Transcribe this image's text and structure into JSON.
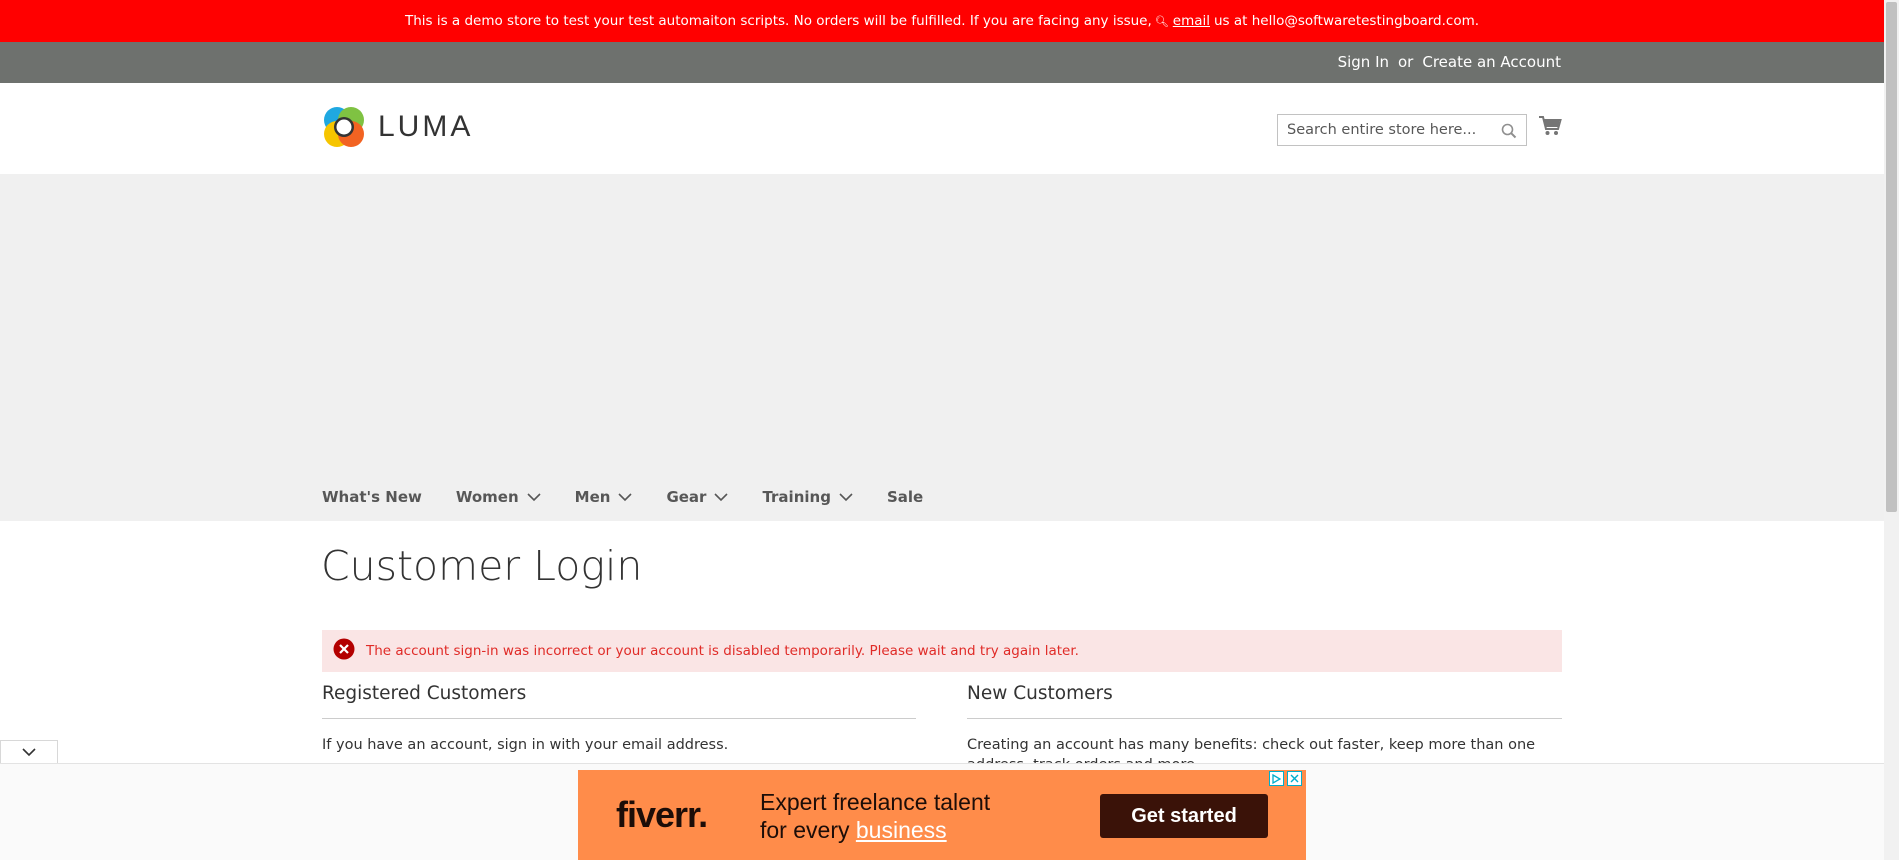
{
  "demo_notice": {
    "text_before": "This is a demo store to test your test automaiton scripts. No orders will be fulfilled. If you are facing any issue,",
    "email_link": "email",
    "text_after": "us at hello@softwaretestingboard.com."
  },
  "account_bar": {
    "sign_in": "Sign In",
    "or": "or",
    "create_account": "Create an Account"
  },
  "header": {
    "logo_text": "LUMA",
    "search_placeholder": "Search entire store here..."
  },
  "nav": {
    "items": [
      {
        "label": "What's New",
        "has_dropdown": false
      },
      {
        "label": "Women",
        "has_dropdown": true
      },
      {
        "label": "Men",
        "has_dropdown": true
      },
      {
        "label": "Gear",
        "has_dropdown": true
      },
      {
        "label": "Training",
        "has_dropdown": true
      },
      {
        "label": "Sale",
        "has_dropdown": false
      }
    ]
  },
  "page": {
    "title": "Customer Login",
    "error_message": "The account sign-in was incorrect or your account is disabled temporarily. Please wait and try again later."
  },
  "registered": {
    "heading": "Registered Customers",
    "text": "If you have an account, sign in with your email address."
  },
  "new_customers": {
    "heading": "New Customers",
    "text": "Creating an account has many benefits: check out faster, keep more than one address, track orders and more."
  },
  "ad": {
    "brand": "fiverr.",
    "tagline_line1": "Expert freelance talent",
    "tagline_line2_prefix": "for every",
    "tagline_line2_link": "business",
    "cta": "Get started"
  },
  "colors": {
    "demo_bar": "#ff0000",
    "account_bar": "#6e716e",
    "banner": "#f0f0f0",
    "error_bg": "#fae5e5",
    "error_text": "#e02b27",
    "ad_bg": "#ff8c4a"
  }
}
